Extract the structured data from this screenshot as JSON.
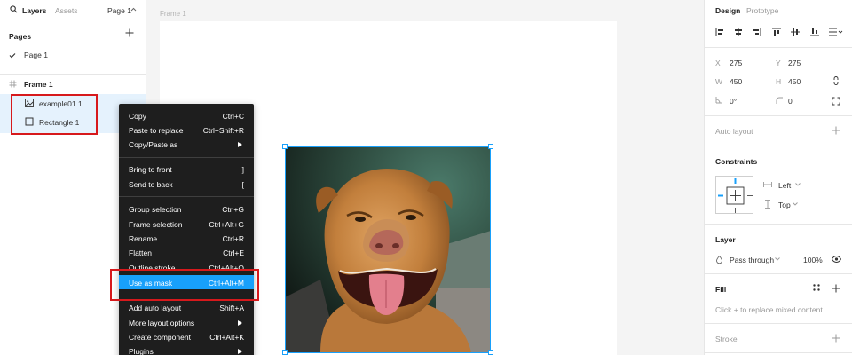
{
  "left_panel": {
    "tabs": {
      "layers": "Layers",
      "assets": "Assets",
      "page_selector": "Page 1"
    },
    "pages_title": "Pages",
    "pages": [
      "Page 1"
    ],
    "layers": {
      "frame": "Frame 1",
      "children": [
        "example01 1",
        "Rectangle 1"
      ]
    }
  },
  "canvas": {
    "frame_label": "Frame 1"
  },
  "context_menu": {
    "items": [
      {
        "label": "Copy",
        "shortcut": "Ctrl+C"
      },
      {
        "label": "Paste to replace",
        "shortcut": "Ctrl+Shift+R"
      },
      {
        "label": "Copy/Paste as",
        "shortcut": ""
      },
      {
        "label": "Bring to front",
        "shortcut": "]"
      },
      {
        "label": "Send to back",
        "shortcut": "["
      },
      {
        "label": "Group selection",
        "shortcut": "Ctrl+G"
      },
      {
        "label": "Frame selection",
        "shortcut": "Ctrl+Alt+G"
      },
      {
        "label": "Rename",
        "shortcut": "Ctrl+R"
      },
      {
        "label": "Flatten",
        "shortcut": "Ctrl+E"
      },
      {
        "label": "Outline stroke",
        "shortcut": "Ctrl+Alt+O"
      },
      {
        "label": "Use as mask",
        "shortcut": "Ctrl+Alt+M"
      },
      {
        "label": "Add auto layout",
        "shortcut": "Shift+A"
      },
      {
        "label": "More layout options",
        "shortcut": ""
      },
      {
        "label": "Create component",
        "shortcut": "Ctrl+Alt+K"
      },
      {
        "label": "Plugins",
        "shortcut": ""
      }
    ],
    "highlighted": "Use as mask"
  },
  "right_panel": {
    "tabs": {
      "design": "Design",
      "prototype": "Prototype"
    },
    "position": {
      "x_label": "X",
      "x": "275",
      "y_label": "Y",
      "y": "275",
      "w_label": "W",
      "w": "450",
      "h_label": "H",
      "h": "450",
      "rotation": "0°",
      "radius": "0"
    },
    "auto_layout": "Auto layout",
    "constraints": {
      "title": "Constraints",
      "horizontal": "Left",
      "vertical": "Top"
    },
    "layer": {
      "title": "Layer",
      "blend": "Pass through",
      "opacity": "100%"
    },
    "fill": {
      "title": "Fill",
      "hint": "Click + to replace mixed content"
    },
    "stroke": "Stroke"
  },
  "colors": {
    "selection": "#18a0fb",
    "menu_bg": "#1e1e1e",
    "annotation_red": "#d7191c"
  }
}
